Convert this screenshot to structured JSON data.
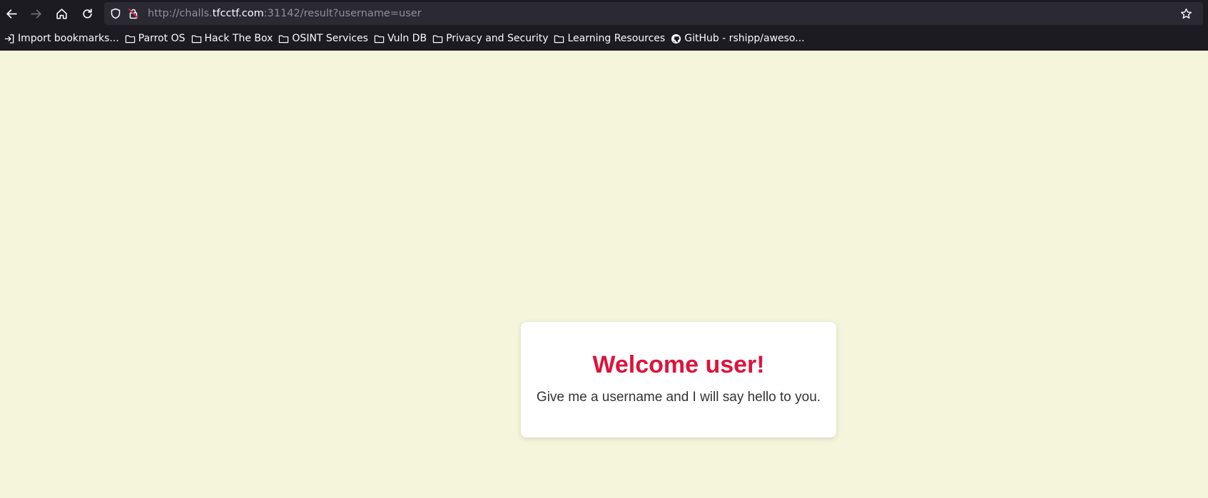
{
  "browser": {
    "url_prefix": "http://challs.",
    "url_host": "tfcctf.com",
    "url_suffix": ":31142/result?username=user",
    "icons": {
      "back": "arrow-left-icon",
      "forward": "arrow-right-icon",
      "home": "home-icon",
      "reload": "reload-icon",
      "tracking_protection": "shield-icon",
      "insecure": "insecure-lock-icon",
      "bookmark_star": "star-icon"
    }
  },
  "bookmarks": [
    {
      "label": "Import bookmarks...",
      "icon": "import-icon"
    },
    {
      "label": "Parrot OS",
      "icon": "folder-icon"
    },
    {
      "label": "Hack The Box",
      "icon": "folder-icon"
    },
    {
      "label": "OSINT Services",
      "icon": "folder-icon"
    },
    {
      "label": "Vuln DB",
      "icon": "folder-icon"
    },
    {
      "label": "Privacy and Security",
      "icon": "folder-icon"
    },
    {
      "label": "Learning Resources",
      "icon": "folder-icon"
    },
    {
      "label": "GitHub - rshipp/aweso...",
      "icon": "github-icon"
    }
  ],
  "page": {
    "heading": "Welcome user!",
    "message": "Give me a username and I will say hello to you.",
    "colors": {
      "background": "#f5f5dc",
      "heading": "#dc143c",
      "text": "#333333",
      "card": "#ffffff"
    }
  }
}
